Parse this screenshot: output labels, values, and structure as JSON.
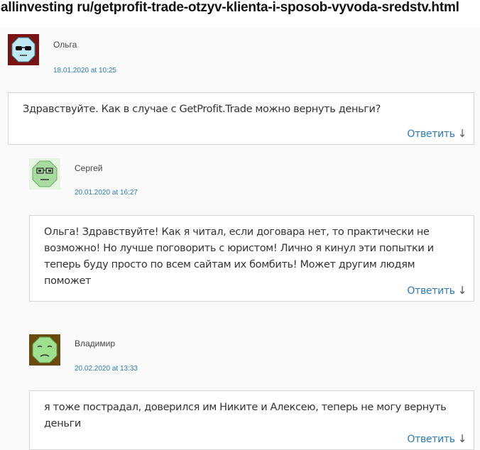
{
  "page_title": "allinvesting ru/getprofit-trade-otzyv-klienta-i-sposob-vyvoda-sredstv.html",
  "comments": [
    {
      "author": "Ольга",
      "date": "18.01.2020 at 10:25",
      "text": "Здравствуйте. Как в случае с GetProfit.Trade можно вернуть деньги?",
      "reply_label": "Ответить",
      "avatar_icon": "black-sunglasses-face-avatar-icon",
      "avatar_color": "#8a1a1a"
    },
    {
      "author": "Сергей",
      "date": "20.01.2020 at 16:27",
      "text": "Ольга! Здравствуйте! Как я читал, если договара нет, то практически не возможно! Но лучше поговорить с юристом! Лично я кинул эти попытки и теперь буду просто по всем сайтам их бомбить! Может другим людям поможет",
      "reply_label": "Ответить",
      "avatar_icon": "glasses-face-avatar-icon",
      "avatar_color": "#c8e8c0"
    },
    {
      "author": "Владимир",
      "date": "20.02.2020 at 13:33",
      "text": "я тоже пострадал, доверился им Никите и Алексею, теперь не могу вернуть деньги",
      "reply_label": "Ответить",
      "avatar_icon": "sad-face-avatar-icon",
      "avatar_color": "#6b4a10"
    }
  ],
  "reply_arrow": "↓"
}
